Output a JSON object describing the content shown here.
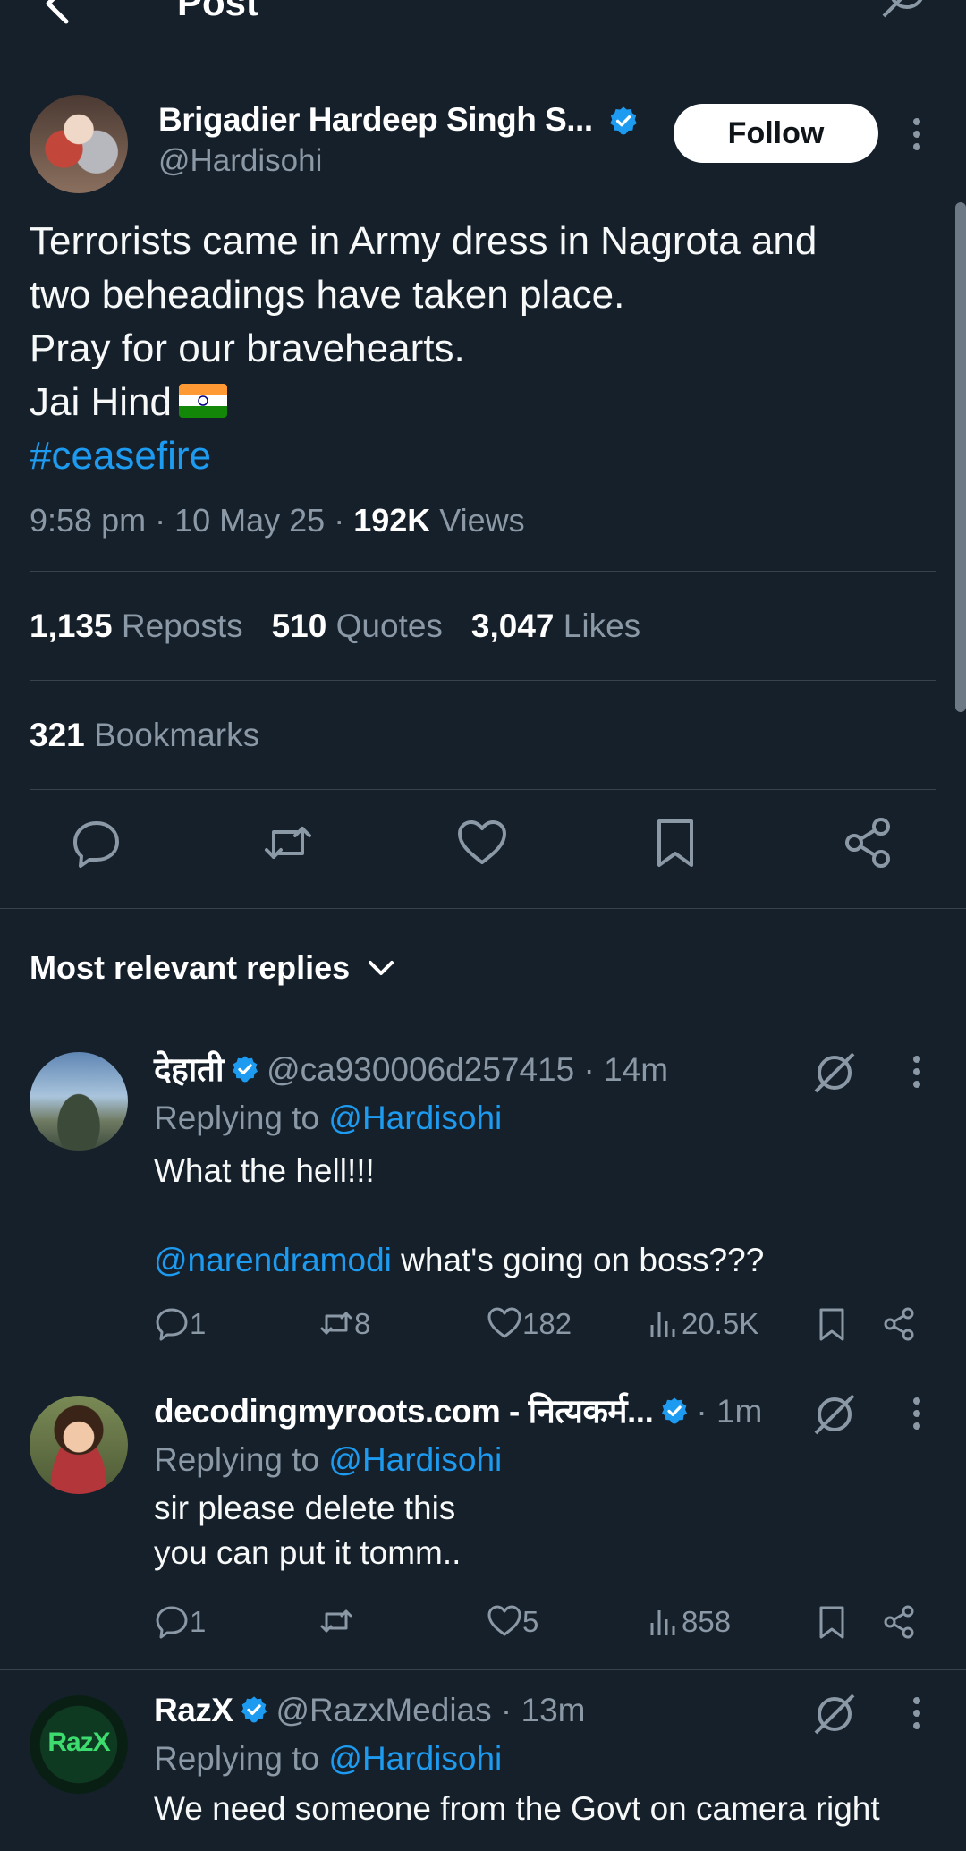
{
  "topbar": {
    "title": "Post"
  },
  "post": {
    "author_name": "Brigadier Hardeep Singh S...",
    "author_handle": "@Hardisohi",
    "follow_label": "Follow",
    "text_lines": [
      "Terrorists came in Army dress in Nagrota and",
      "two beheadings have taken place.",
      "Pray for our bravehearts.",
      "Jai Hind"
    ],
    "hashtag": "#ceasefire",
    "time": "9:58 pm",
    "date": "10 May 25",
    "views_count": "192K",
    "views_label": "Views",
    "reposts_count": "1,135",
    "reposts_label": "Reposts",
    "quotes_count": "510",
    "quotes_label": "Quotes",
    "likes_count": "3,047",
    "likes_label": "Likes",
    "bookmarks_count": "321",
    "bookmarks_label": "Bookmarks"
  },
  "replies_header": "Most relevant replies",
  "replies": [
    {
      "name": "देहाती",
      "handle": "@ca930006d257415",
      "time": "14m",
      "replying_prefix": "Replying to",
      "replying_to": "@Hardisohi",
      "body_line1": "What the hell!!!",
      "body_mention": "@narendramodi",
      "body_line2": "what's going on boss???",
      "replies": "1",
      "reposts": "8",
      "likes": "182",
      "views": "20.5K"
    },
    {
      "name": "decodingmyroots.com - नित्यकर्म...",
      "time": "1m",
      "replying_prefix": "Replying to",
      "replying_to": "@Hardisohi",
      "body_line1": "sir please delete this",
      "body_line2": "you can put it tomm..",
      "replies": "1",
      "reposts": "",
      "likes": "5",
      "views": "858"
    },
    {
      "name": "RazX",
      "handle": "@RazxMedias",
      "time": "13m",
      "replying_prefix": "Replying to",
      "replying_to": "@Hardisohi",
      "body_line1": "We need someone from the Govt on camera right",
      "avatar_text": "RazX"
    }
  ],
  "colors": {
    "background": "#15202b",
    "accent": "#1d9bf0",
    "muted": "#8b98a5",
    "divider": "#38444d"
  },
  "icons": [
    "back-arrow-icon",
    "grok-icon",
    "verified-icon",
    "more-icon",
    "reply-icon",
    "repost-icon",
    "like-icon",
    "bookmark-icon",
    "share-icon",
    "views-icon",
    "chevron-down-icon"
  ]
}
